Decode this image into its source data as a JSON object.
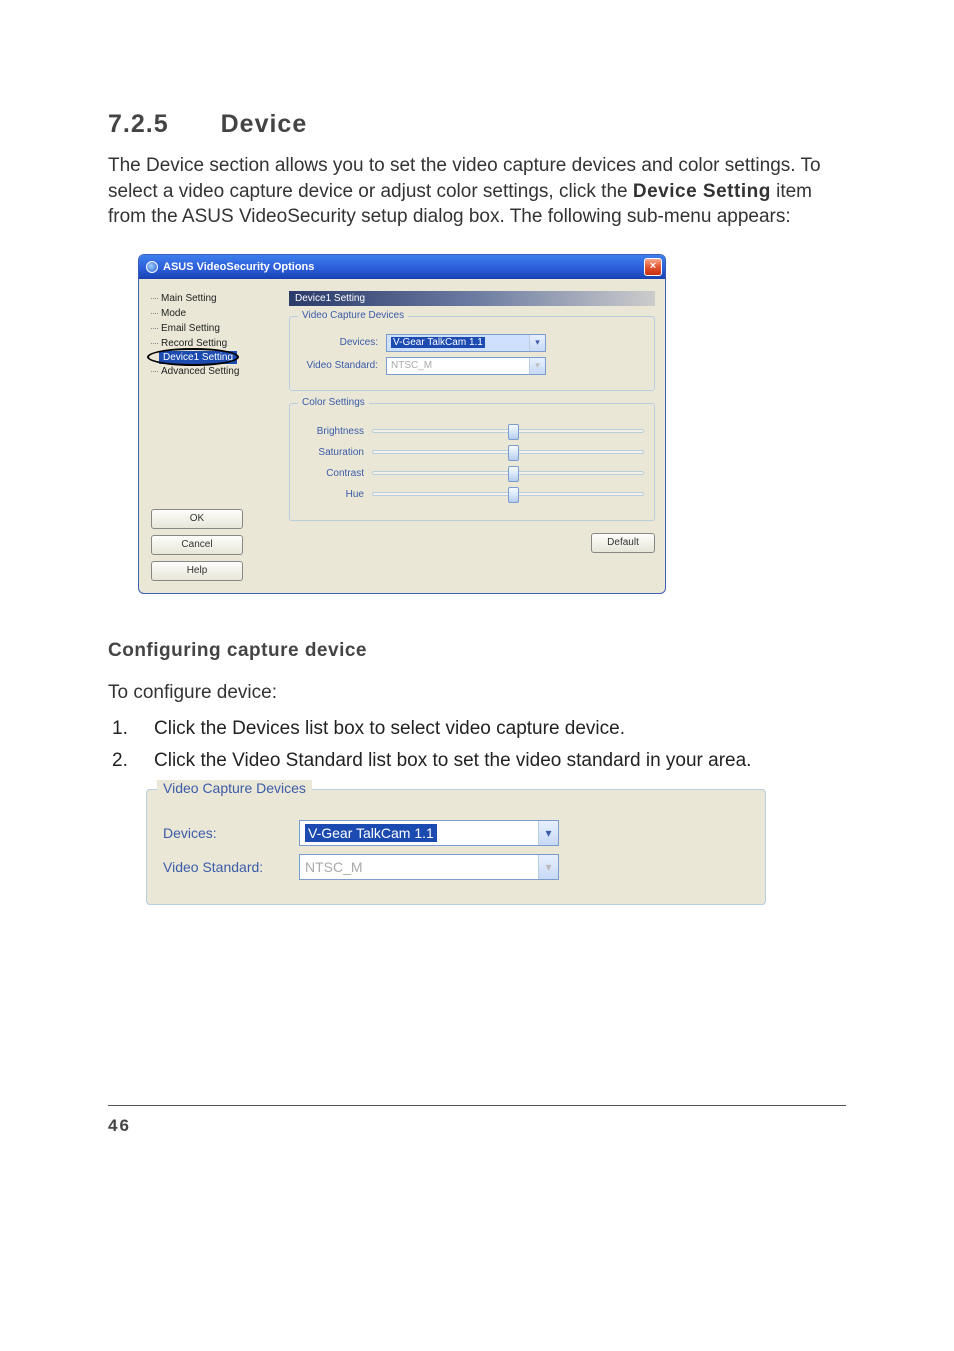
{
  "heading": {
    "number": "7.2.5",
    "title": "Device"
  },
  "intro": {
    "part1": "The Device section allows you to set the video capture devices and color settings. To select a video capture device or adjust color settings, click the ",
    "bold": "Device Setting",
    "part2": " item from the ASUS VideoSecurity setup dialog box. The following sub-menu appears:"
  },
  "dialog": {
    "title": "ASUS VideoSecurity Options",
    "close": "×",
    "tree": {
      "items": [
        "Main Setting",
        "Mode",
        "Email Setting",
        "Record Setting",
        "Device1 Setting",
        "Advanced Setting"
      ],
      "selected_index": 4
    },
    "pane_header": "Device1 Setting",
    "group_video": {
      "title": "Video Capture Devices",
      "label_devices": "Devices:",
      "value_devices": "V-Gear TalkCam 1.1",
      "label_standard": "Video Standard:",
      "value_standard": "NTSC_M"
    },
    "group_color": {
      "title": "Color Settings",
      "sliders": [
        "Brightness",
        "Saturation",
        "Contrast",
        "Hue"
      ],
      "thumb_pct": 50
    },
    "default_btn": "Default",
    "buttons": {
      "ok": "OK",
      "cancel": "Cancel",
      "help": "Help"
    }
  },
  "sub": {
    "heading": "Configuring capture device",
    "lead": "To configure device:",
    "steps": [
      {
        "n": "1.",
        "pre": "Click the ",
        "bold": "Devices",
        "post": " list box to select video capture device."
      },
      {
        "n": "2.",
        "pre": "Click the ",
        "bold": "Video Standard",
        "post": " list box to set the video standard in your area."
      }
    ]
  },
  "zoom": {
    "title": "Video Capture Devices",
    "label_devices": "Devices:",
    "value_devices": "V-Gear TalkCam 1.1",
    "label_standard": "Video Standard:",
    "value_standard": "NTSC_M"
  },
  "page_number": "46"
}
